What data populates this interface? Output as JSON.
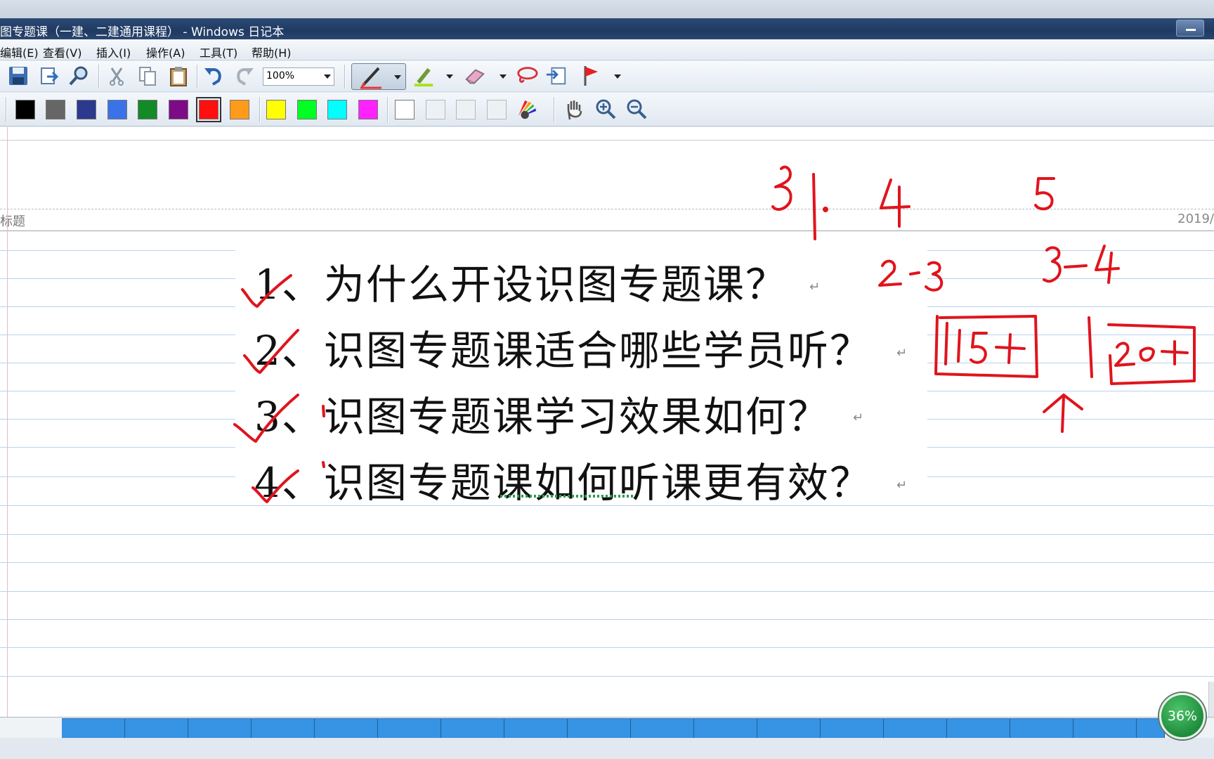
{
  "window": {
    "title": "图专题课（一建、二建通用课程） - Windows 日记本"
  },
  "menu": {
    "items": [
      {
        "label": "编辑(E)"
      },
      {
        "label": "查看(V)"
      },
      {
        "label": "插入(I)"
      },
      {
        "label": "操作(A)"
      },
      {
        "label": "工具(T)"
      },
      {
        "label": "帮助(H)"
      }
    ]
  },
  "toolbar": {
    "zoom_value": "100%",
    "icons": [
      "save-icon",
      "export-icon",
      "find-icon",
      "cut-icon",
      "copy-icon",
      "paste-icon",
      "undo-icon",
      "redo-icon",
      "pen-icon",
      "highlighter-icon",
      "eraser-icon",
      "lasso-icon",
      "insert-space-icon",
      "flag-icon",
      "hand-icon",
      "zoom-in-icon",
      "zoom-out-icon"
    ],
    "colors": [
      "#000000",
      "#666666",
      "#2b3a8f",
      "#3a73e8",
      "#138a26",
      "#7e0b86",
      "#ff1010",
      "#ff9b1a",
      "#ffff00",
      "#00ff22",
      "#00ffff",
      "#ff22ff",
      "#ffffff",
      "#eef1f4",
      "#eef1f4",
      "#eef1f4"
    ]
  },
  "page": {
    "title_fragment": "标题",
    "date_fragment": "2019/",
    "lines": [
      "1、为什么开设识图专题课？",
      "2、识图专题课适合哪些学员听？",
      "3、识图专题课学习效果如何？",
      "4、识图专题课如何听课更有效？"
    ],
    "ink_annotations": [
      "3.",
      "4",
      "5",
      "2-3",
      "3-4",
      "15+",
      "20+"
    ]
  },
  "status": {
    "progress_percent": "36%"
  }
}
